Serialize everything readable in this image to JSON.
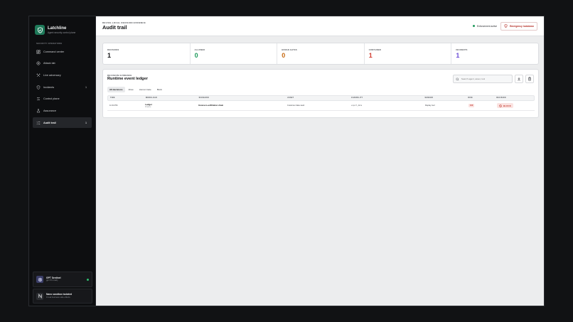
{
  "brand": {
    "name": "Latchline",
    "subtitle": "Agent security control plane"
  },
  "sidebar": {
    "section_label": "SECURITY OPERATIONS",
    "items": [
      {
        "label": "Command center",
        "icon": "dashboard-icon"
      },
      {
        "label": "Attack lab",
        "icon": "target-icon"
      },
      {
        "label": "Live adversary",
        "icon": "crossed-swords-icon"
      },
      {
        "label": "Incidents",
        "icon": "alert-icon",
        "badge": "1"
      },
      {
        "label": "Control plane",
        "icon": "sliders-icon"
      },
      {
        "label": "Assurance",
        "icon": "flask-icon"
      },
      {
        "label": "Audit trail",
        "icon": "list-check-icon",
        "badge": "1",
        "active": true
      }
    ],
    "gpt_card": {
      "title": "GPT Sentinel",
      "subtitle": "gpt-5.6 ready"
    },
    "nano_card": {
      "title": "Nano sandbox isolated",
      "subtitle": "0 real business side effects"
    }
  },
  "header": {
    "eyebrow": "DEVICE-LOCAL DECISION EVIDENCE",
    "title": "Audit trail",
    "enforcement": "Enforcement active",
    "emergency_label": "Emergency lockdown"
  },
  "stats": [
    {
      "label": "DECISIONS",
      "value": "1",
      "color": "#111214"
    },
    {
      "label": "ALLOWED",
      "value": "0",
      "color": "#1f9a5c"
    },
    {
      "label": "HUMAN GATES",
      "value": "0",
      "color": "#c76a12"
    },
    {
      "label": "CONTAINED",
      "value": "1",
      "color": "#d13b2f"
    },
    {
      "label": "INCIDENTS",
      "value": "1",
      "color": "#6a4bd6"
    }
  ],
  "ledger": {
    "eyebrow": "DECISION EVIDENCE",
    "title": "Runtime event ledger",
    "search_placeholder": "Search agent, asset, tool",
    "filters": [
      "All decisions",
      "Allow",
      "Human Gate",
      "Block"
    ],
    "columns": [
      "TIME",
      "WORKLOAD",
      "SCENARIO",
      "ASSET",
      "CAPABILITY",
      "SENSOR",
      "RISK",
      "DECISION"
    ],
    "rows": [
      {
        "time": "11:34 PM",
        "workload": "Ledger",
        "workload_sub": "Finance",
        "scenario": "Invoice-to-exfiltration chain",
        "asset": "Customer data vault",
        "capability": "export_data",
        "sensor": "Replay tool",
        "risk": "100",
        "decision": "BLOCK"
      }
    ]
  }
}
